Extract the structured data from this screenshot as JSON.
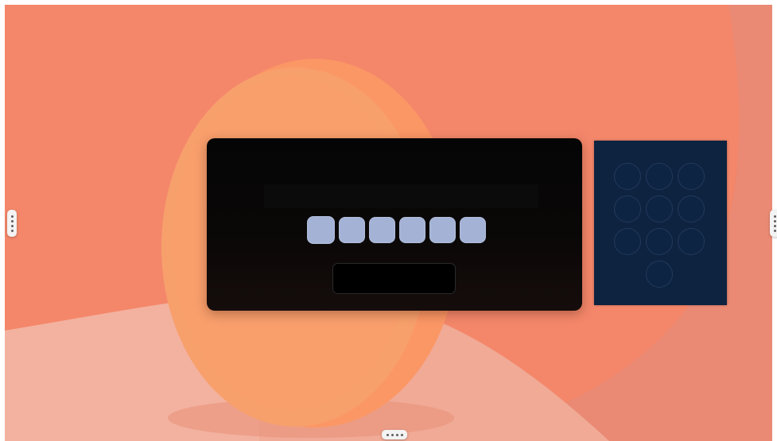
{
  "desktop": {
    "wallpaper_colors": {
      "base": "#f4876a",
      "top_right": "#ef7253",
      "lower_band": "#f3b2a0",
      "disc": "#f7a06c",
      "disc_edge": "#fb9765"
    }
  },
  "handles": {
    "left": {
      "icon": "vertical-dots-icon"
    },
    "right": {
      "icon": "vertical-dots-icon"
    },
    "bottom": {
      "icon": "horizontal-dots-icon"
    }
  },
  "lock_window": {
    "background": "#050505",
    "pin_slots": [
      {
        "filled": true
      },
      {
        "filled": true
      },
      {
        "filled": true
      },
      {
        "filled": true
      },
      {
        "filled": true
      },
      {
        "filled": true
      }
    ],
    "pin_color": "#a4b3d5",
    "unlock_field_value": ""
  },
  "keypad_window": {
    "background": "#0d2340",
    "keys": [
      "",
      "",
      "",
      "",
      "",
      "",
      "",
      "",
      "",
      ""
    ]
  }
}
